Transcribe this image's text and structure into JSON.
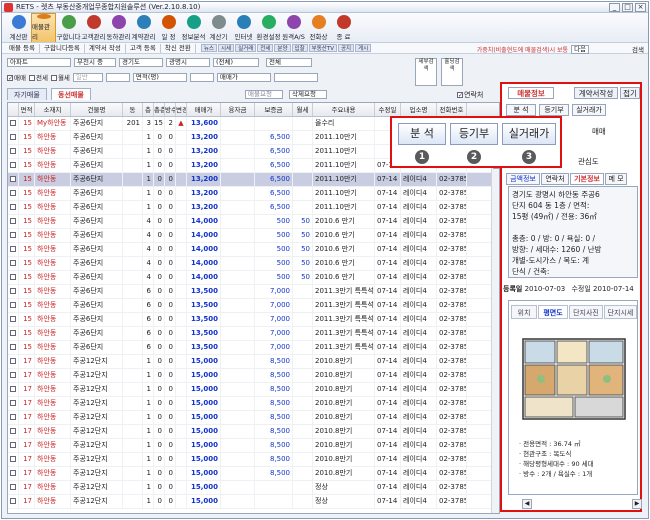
{
  "window": {
    "title": "RETS - 렛츠 부동산중개업무종합지원솔루션  (Ver.2.10.8.10)",
    "minimize": "_",
    "maximize": "□",
    "close": "×"
  },
  "toolbar": {
    "items": [
      {
        "label": "계산판",
        "icon": "calculator-icon",
        "color": "#3a7bd5"
      },
      {
        "label": "매물관리",
        "icon": "house-icon",
        "color": "#e07b1a"
      },
      {
        "label": "구합니다",
        "icon": "search-person-icon",
        "color": "#4a9e4a"
      },
      {
        "label": "고객관리",
        "icon": "customer-icon",
        "color": "#c0392b"
      },
      {
        "label": "동하관리",
        "icon": "people-icon",
        "color": "#8e44ad"
      },
      {
        "label": "계약관리",
        "icon": "contract-icon",
        "color": "#2c7fb8"
      },
      {
        "label": "일 정",
        "icon": "calendar-icon",
        "color": "#d35400"
      },
      {
        "label": "정보분석",
        "icon": "chart-icon",
        "color": "#16a085"
      },
      {
        "label": "계산기",
        "icon": "calc-icon",
        "color": "#7f8c8d"
      },
      {
        "label": "인터넷",
        "icon": "internet-icon",
        "color": "#2980b9"
      },
      {
        "label": "환경설정",
        "icon": "settings-icon",
        "color": "#27ae60"
      },
      {
        "label": "원격A/S",
        "icon": "remote-icon",
        "color": "#8e44ad"
      },
      {
        "label": "전화상",
        "icon": "phone-icon",
        "color": "#e67e22"
      },
      {
        "label": "종 료",
        "icon": "exit-icon",
        "color": "#c0392b"
      }
    ]
  },
  "menubar": {
    "items": [
      "매물 등록",
      "구합니다등록",
      "계약서 작성",
      "고객 등록",
      "착신 전환"
    ],
    "mini_tabs": [
      "뉴스",
      "시세",
      "실거래",
      "전세",
      "분양",
      "입찰",
      "부동산TV",
      "공지",
      "게시"
    ],
    "notice": "가중치(비출현도에 매물검색)시 보통",
    "nav_select": "다음",
    "search_label": "검색"
  },
  "filters": {
    "type": "아파트",
    "region1": "부천시 중",
    "region2": "경기도",
    "region3": "광명시",
    "region4": "(전체)",
    "all_label": "전체",
    "checkboxes": [
      {
        "label": "매매",
        "checked": true
      },
      {
        "label": "전세",
        "checked": false
      },
      {
        "label": "월세",
        "checked": false
      }
    ],
    "exclude_label": "일반",
    "area_label": "면적(평)",
    "extra_label": "매매가",
    "reset_label": "세부검색",
    "hold_label": "홀딩검색",
    "req_btn": "매물요청",
    "confirm_btn": "삭제요청",
    "linked_label": "연락처"
  },
  "tabs": {
    "left": [
      "자기매물",
      "동선매물"
    ],
    "active": 1
  },
  "grid": {
    "headers": [
      "",
      "면적",
      "소재지",
      "건물명",
      "동",
      "층",
      "총층",
      "방수",
      "변경",
      "매매가",
      "융자금",
      "보증금",
      "월세",
      "주요내용",
      "수정일",
      "업소명",
      "전화번호"
    ],
    "rows": [
      {
        "chk": "",
        "area": "15",
        "loc": "My하안동",
        "bldg": "주공6단지",
        "dong": "201",
        "floor": "3",
        "total": "15",
        "rooms": "2",
        "flag": "▲",
        "price": "13,600",
        "loan": "",
        "deposit": "",
        "rent": "",
        "desc": "올수리",
        "date": "",
        "office": "",
        "phone": ""
      },
      {
        "chk": "",
        "area": "15",
        "loc": "하안동",
        "bldg": "주공6단지",
        "dong": "",
        "floor": "1",
        "total": "0",
        "rooms": "0",
        "flag": "",
        "price": "13,200",
        "loan": "",
        "deposit": "6,500",
        "rent": "",
        "desc": "2011.10만기",
        "date": "",
        "office": "",
        "phone": ""
      },
      {
        "chk": "",
        "area": "15",
        "loc": "하안동",
        "bldg": "주공6단지",
        "dong": "",
        "floor": "1",
        "total": "0",
        "rooms": "0",
        "flag": "",
        "price": "13,200",
        "loan": "",
        "deposit": "6,500",
        "rent": "",
        "desc": "2011.10만기",
        "date": "",
        "office": "",
        "phone": ""
      },
      {
        "chk": "",
        "area": "15",
        "loc": "하안동",
        "bldg": "주공6단지",
        "dong": "",
        "floor": "1",
        "total": "0",
        "rooms": "0",
        "flag": "",
        "price": "13,200",
        "loan": "",
        "deposit": "6,500",
        "rent": "",
        "desc": "2011.10만기",
        "date": "07-14",
        "office": "레이디4",
        "phone": "02-3785-"
      },
      {
        "chk": "",
        "area": "15",
        "loc": "하안동",
        "bldg": "주공6단지",
        "dong": "",
        "floor": "1",
        "total": "0",
        "rooms": "0",
        "flag": "",
        "price": "13,200",
        "loan": "",
        "deposit": "6,500",
        "rent": "",
        "desc": "2011.10만기",
        "date": "07-14",
        "office": "레이디4",
        "phone": "02-3785-",
        "hl": true
      },
      {
        "chk": "",
        "area": "15",
        "loc": "하안동",
        "bldg": "주공6단지",
        "dong": "",
        "floor": "1",
        "total": "0",
        "rooms": "0",
        "flag": "",
        "price": "13,200",
        "loan": "",
        "deposit": "6,500",
        "rent": "",
        "desc": "2011.10만기",
        "date": "07-14",
        "office": "레이디4",
        "phone": "02-3785-"
      },
      {
        "chk": "",
        "area": "15",
        "loc": "하안동",
        "bldg": "주공6단지",
        "dong": "",
        "floor": "1",
        "total": "0",
        "rooms": "0",
        "flag": "",
        "price": "13,200",
        "loan": "",
        "deposit": "6,500",
        "rent": "",
        "desc": "2011.10만기",
        "date": "07-14",
        "office": "레이디4",
        "phone": "02-3785-"
      },
      {
        "chk": "",
        "area": "15",
        "loc": "하안동",
        "bldg": "주공6단지",
        "dong": "",
        "floor": "4",
        "total": "0",
        "rooms": "0",
        "flag": "",
        "price": "14,000",
        "loan": "",
        "deposit": "500",
        "rent": "50",
        "desc": "2010.6 만기",
        "date": "07-14",
        "office": "레이디4",
        "phone": "02-3785-"
      },
      {
        "chk": "",
        "area": "15",
        "loc": "하안동",
        "bldg": "주공6단지",
        "dong": "",
        "floor": "4",
        "total": "0",
        "rooms": "0",
        "flag": "",
        "price": "14,000",
        "loan": "",
        "deposit": "500",
        "rent": "50",
        "desc": "2010.6 만기",
        "date": "07-14",
        "office": "레이디4",
        "phone": "02-3785-"
      },
      {
        "chk": "",
        "area": "15",
        "loc": "하안동",
        "bldg": "주공6단지",
        "dong": "",
        "floor": "4",
        "total": "0",
        "rooms": "0",
        "flag": "",
        "price": "14,000",
        "loan": "",
        "deposit": "500",
        "rent": "50",
        "desc": "2010.6 만기",
        "date": "07-14",
        "office": "레이디4",
        "phone": "02-3785-"
      },
      {
        "chk": "",
        "area": "15",
        "loc": "하안동",
        "bldg": "주공6단지",
        "dong": "",
        "floor": "4",
        "total": "0",
        "rooms": "0",
        "flag": "",
        "price": "14,000",
        "loan": "",
        "deposit": "500",
        "rent": "50",
        "desc": "2010.6 만기",
        "date": "07-14",
        "office": "레이디4",
        "phone": "02-3785-"
      },
      {
        "chk": "",
        "area": "15",
        "loc": "하안동",
        "bldg": "주공6단지",
        "dong": "",
        "floor": "4",
        "total": "0",
        "rooms": "0",
        "flag": "",
        "price": "14,000",
        "loan": "",
        "deposit": "500",
        "rent": "50",
        "desc": "2010.6 만기",
        "date": "07-14",
        "office": "레이디4",
        "phone": "02-3785-"
      },
      {
        "chk": "",
        "area": "15",
        "loc": "하안동",
        "bldg": "주공6단지",
        "dong": "",
        "floor": "6",
        "total": "0",
        "rooms": "0",
        "flag": "",
        "price": "13,500",
        "loan": "",
        "deposit": "7,000",
        "rent": "",
        "desc": "2011.3만기 특특석",
        "date": "07-14",
        "office": "레이디4",
        "phone": "02-3785-"
      },
      {
        "chk": "",
        "area": "15",
        "loc": "하안동",
        "bldg": "주공6단지",
        "dong": "",
        "floor": "6",
        "total": "0",
        "rooms": "0",
        "flag": "",
        "price": "13,500",
        "loan": "",
        "deposit": "7,000",
        "rent": "",
        "desc": "2011.3만기 특특석",
        "date": "07-14",
        "office": "레이디4",
        "phone": "02-3785-"
      },
      {
        "chk": "",
        "area": "15",
        "loc": "하안동",
        "bldg": "주공6단지",
        "dong": "",
        "floor": "6",
        "total": "0",
        "rooms": "0",
        "flag": "",
        "price": "13,500",
        "loan": "",
        "deposit": "7,000",
        "rent": "",
        "desc": "2011.3만기 특특석",
        "date": "07-14",
        "office": "레이디4",
        "phone": "02-3785-"
      },
      {
        "chk": "",
        "area": "15",
        "loc": "하안동",
        "bldg": "주공6단지",
        "dong": "",
        "floor": "6",
        "total": "0",
        "rooms": "0",
        "flag": "",
        "price": "13,500",
        "loan": "",
        "deposit": "7,000",
        "rent": "",
        "desc": "2011.3만기 특특석",
        "date": "07-14",
        "office": "레이디4",
        "phone": "02-3785-"
      },
      {
        "chk": "",
        "area": "15",
        "loc": "하안동",
        "bldg": "주공6단지",
        "dong": "",
        "floor": "6",
        "total": "0",
        "rooms": "0",
        "flag": "",
        "price": "13,500",
        "loan": "",
        "deposit": "7,000",
        "rent": "",
        "desc": "2011.3만기 특특석",
        "date": "07-14",
        "office": "레이디4",
        "phone": "02-3785-"
      },
      {
        "chk": "",
        "area": "17",
        "loc": "하안동",
        "bldg": "주공12단지",
        "dong": "",
        "floor": "1",
        "total": "0",
        "rooms": "0",
        "flag": "",
        "price": "15,000",
        "loan": "",
        "deposit": "8,500",
        "rent": "",
        "desc": "2010.8만기",
        "date": "07-14",
        "office": "레이디4",
        "phone": "02-3785-"
      },
      {
        "chk": "",
        "area": "17",
        "loc": "하안동",
        "bldg": "주공12단지",
        "dong": "",
        "floor": "1",
        "total": "0",
        "rooms": "0",
        "flag": "",
        "price": "15,000",
        "loan": "",
        "deposit": "8,500",
        "rent": "",
        "desc": "2010.8만기",
        "date": "07-14",
        "office": "레이디4",
        "phone": "02-3785-"
      },
      {
        "chk": "",
        "area": "17",
        "loc": "하안동",
        "bldg": "주공12단지",
        "dong": "",
        "floor": "1",
        "total": "0",
        "rooms": "0",
        "flag": "",
        "price": "15,000",
        "loan": "",
        "deposit": "8,500",
        "rent": "",
        "desc": "2010.8만기",
        "date": "07-14",
        "office": "레이디4",
        "phone": "02-3785-"
      },
      {
        "chk": "",
        "area": "17",
        "loc": "하안동",
        "bldg": "주공12단지",
        "dong": "",
        "floor": "1",
        "total": "0",
        "rooms": "0",
        "flag": "",
        "price": "15,000",
        "loan": "",
        "deposit": "8,500",
        "rent": "",
        "desc": "2010.8만기",
        "date": "07-14",
        "office": "레이디4",
        "phone": "02-3785-"
      },
      {
        "chk": "",
        "area": "17",
        "loc": "하안동",
        "bldg": "주공12단지",
        "dong": "",
        "floor": "1",
        "total": "0",
        "rooms": "0",
        "flag": "",
        "price": "15,000",
        "loan": "",
        "deposit": "8,500",
        "rent": "",
        "desc": "2010.8만기",
        "date": "07-14",
        "office": "레이디4",
        "phone": "02-3785-"
      },
      {
        "chk": "",
        "area": "17",
        "loc": "하안동",
        "bldg": "주공12단지",
        "dong": "",
        "floor": "1",
        "total": "0",
        "rooms": "0",
        "flag": "",
        "price": "15,000",
        "loan": "",
        "deposit": "8,500",
        "rent": "",
        "desc": "2010.8만기",
        "date": "07-14",
        "office": "레이디4",
        "phone": "02-3785-"
      },
      {
        "chk": "",
        "area": "17",
        "loc": "하안동",
        "bldg": "주공12단지",
        "dong": "",
        "floor": "1",
        "total": "0",
        "rooms": "0",
        "flag": "",
        "price": "15,000",
        "loan": "",
        "deposit": "8,500",
        "rent": "",
        "desc": "2010.8만기",
        "date": "07-14",
        "office": "레이디4",
        "phone": "02-3785-"
      },
      {
        "chk": "",
        "area": "17",
        "loc": "하안동",
        "bldg": "주공12단지",
        "dong": "",
        "floor": "1",
        "total": "0",
        "rooms": "0",
        "flag": "",
        "price": "15,000",
        "loan": "",
        "deposit": "8,500",
        "rent": "",
        "desc": "2010.8만기",
        "date": "07-14",
        "office": "레이디4",
        "phone": "02-3785-"
      },
      {
        "chk": "",
        "area": "17",
        "loc": "하안동",
        "bldg": "주공12단지",
        "dong": "",
        "floor": "1",
        "total": "0",
        "rooms": "0",
        "flag": "",
        "price": "15,000",
        "loan": "",
        "deposit": "8,500",
        "rent": "",
        "desc": "2010.8만기",
        "date": "07-14",
        "office": "레이디4",
        "phone": "02-3785-"
      },
      {
        "chk": "",
        "area": "17",
        "loc": "하안동",
        "bldg": "주공12단지",
        "dong": "",
        "floor": "1",
        "total": "0",
        "rooms": "0",
        "flag": "",
        "price": "15,000",
        "loan": "",
        "deposit": "",
        "rent": "",
        "desc": "정상",
        "date": "07-14",
        "office": "레이디4",
        "phone": "02-3785-"
      },
      {
        "chk": "",
        "area": "17",
        "loc": "하안동",
        "bldg": "주공12단지",
        "dong": "",
        "floor": "1",
        "total": "0",
        "rooms": "0",
        "flag": "",
        "price": "15,000",
        "loan": "",
        "deposit": "",
        "rent": "",
        "desc": "정상",
        "date": "07-14",
        "office": "레이디4",
        "phone": "02-3785-"
      }
    ]
  },
  "popup": {
    "buttons": [
      "분 석",
      "등기부",
      "실거래가"
    ],
    "numbers": [
      "1",
      "2",
      "3"
    ]
  },
  "right": {
    "tabs": [
      "매물정보",
      "계약서작성",
      "접기"
    ],
    "subbuttons": [
      "분 석",
      "등기부",
      "실거래가"
    ],
    "trade_label": "매매",
    "relevance": "관심도",
    "info_tabs": [
      "금액정보",
      "연락처",
      "기본정보",
      "메 모"
    ],
    "desc_lines": [
      "경기도 광명시 하안동 주공6",
      "단지 604    동 1층 / 면적:",
      "15평 (49㎡) / 전용: 36㎡",
      "",
      "총층: 0 / 방: 0 / 욕실: 0 /",
      "방향:   / 세대수: 1260 / 난방",
      "개별-도시가스 / 복도: 계",
      "단식 / 건축:"
    ],
    "reg_label": "등록일",
    "reg_date": "2010-07-03",
    "mod_label": "수정일",
    "mod_date": "2010-07-14",
    "floor_tabs": [
      "위치",
      "평면도",
      "단지사진",
      "단지시세"
    ],
    "floor_info": [
      "· 전용면적 : 36.74 ㎡",
      "· 현관구조 : 복도식",
      "· 해당평형세대수 : 90 세대",
      "· 방수 : 2개 / 욕실수 : 1개"
    ]
  }
}
